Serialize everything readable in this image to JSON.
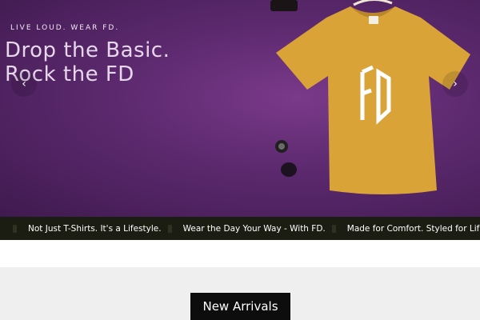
{
  "hero": {
    "tagline": "LIVE LOUD. WEAR FD.",
    "headline_line1": "Drop the Basic.",
    "headline_line2": "Rock the FD",
    "shirt_logo": "FD",
    "prev_icon": "chevron-left-icon",
    "next_icon": "chevron-right-icon",
    "background_color": "#5e2a70",
    "shirt_color": "#d9a338"
  },
  "ticker": {
    "items": [
      "Not Just T-Shirts. It's a Lifestyle.",
      "Wear the Day Your Way - With FD.",
      "Made for Comfort. Styled for Life."
    ],
    "background_color": "#1b1d12"
  },
  "new_arrivals": {
    "title": "New Arrivals"
  }
}
